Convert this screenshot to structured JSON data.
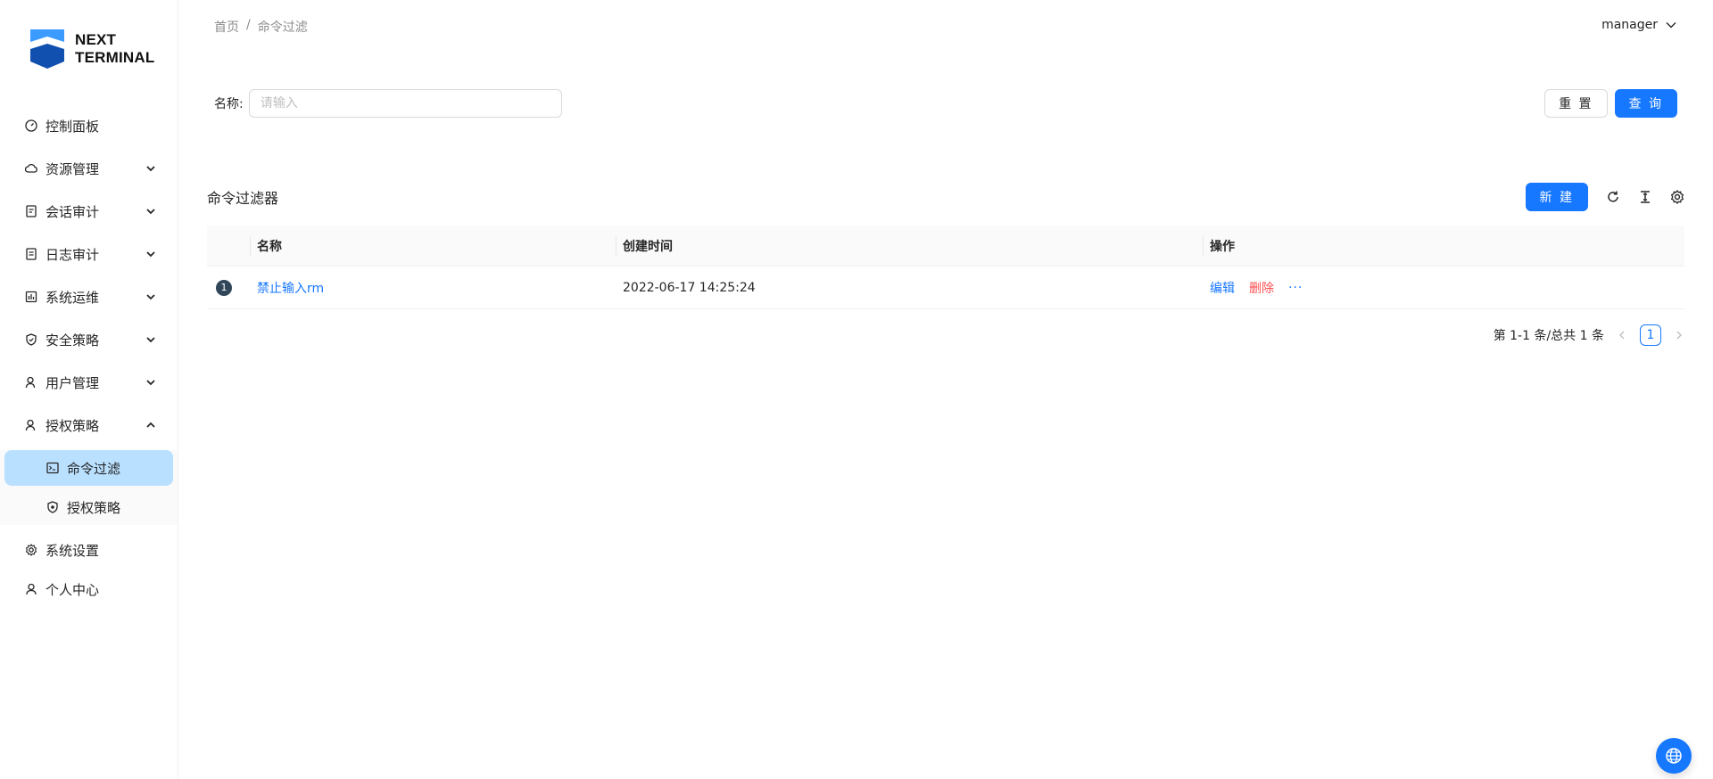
{
  "app": {
    "logo_line1": "NEXT",
    "logo_line2": "TERMINAL"
  },
  "sidebar": {
    "items": [
      {
        "label": "控制面板",
        "icon": "dashboard-icon",
        "has_children": false
      },
      {
        "label": "资源管理",
        "icon": "cloud-icon",
        "has_children": true
      },
      {
        "label": "会话审计",
        "icon": "audit-icon",
        "has_children": true
      },
      {
        "label": "日志审计",
        "icon": "log-icon",
        "has_children": true
      },
      {
        "label": "系统运维",
        "icon": "ops-icon",
        "has_children": true
      },
      {
        "label": "安全策略",
        "icon": "shield-icon",
        "has_children": true
      },
      {
        "label": "用户管理",
        "icon": "user-icon",
        "has_children": true
      },
      {
        "label": "授权策略",
        "icon": "user-icon",
        "has_children": true,
        "expanded": true
      }
    ],
    "subitems": [
      {
        "label": "命令过滤",
        "icon": "terminal-icon",
        "active": true
      },
      {
        "label": "授权策略",
        "icon": "shield-icon",
        "active": false
      }
    ],
    "bottom_items": [
      {
        "label": "系统设置",
        "icon": "gear-icon"
      },
      {
        "label": "个人中心",
        "icon": "user-icon"
      }
    ]
  },
  "header": {
    "breadcrumb_home": "首页",
    "breadcrumb_sep": "/",
    "breadcrumb_current": "命令过滤",
    "username": "manager"
  },
  "search": {
    "label": "名称:",
    "placeholder": "请输入",
    "reset_label": "重 置",
    "query_label": "查 询"
  },
  "table": {
    "title": "命令过滤器",
    "new_label": "新 建",
    "columns": [
      "名称",
      "创建时间",
      "操作"
    ],
    "rows": [
      {
        "index": "1",
        "name": "禁止输入rm",
        "created": "2022-06-17 14:25:24",
        "edit": "编辑",
        "delete": "删除",
        "more": "···"
      }
    ]
  },
  "pagination": {
    "summary": "第 1-1 条/总共 1 条",
    "current_page": "1"
  },
  "colors": {
    "primary": "#1677ff",
    "danger": "#ff4d4f",
    "active_bg": "#bae0ff"
  }
}
